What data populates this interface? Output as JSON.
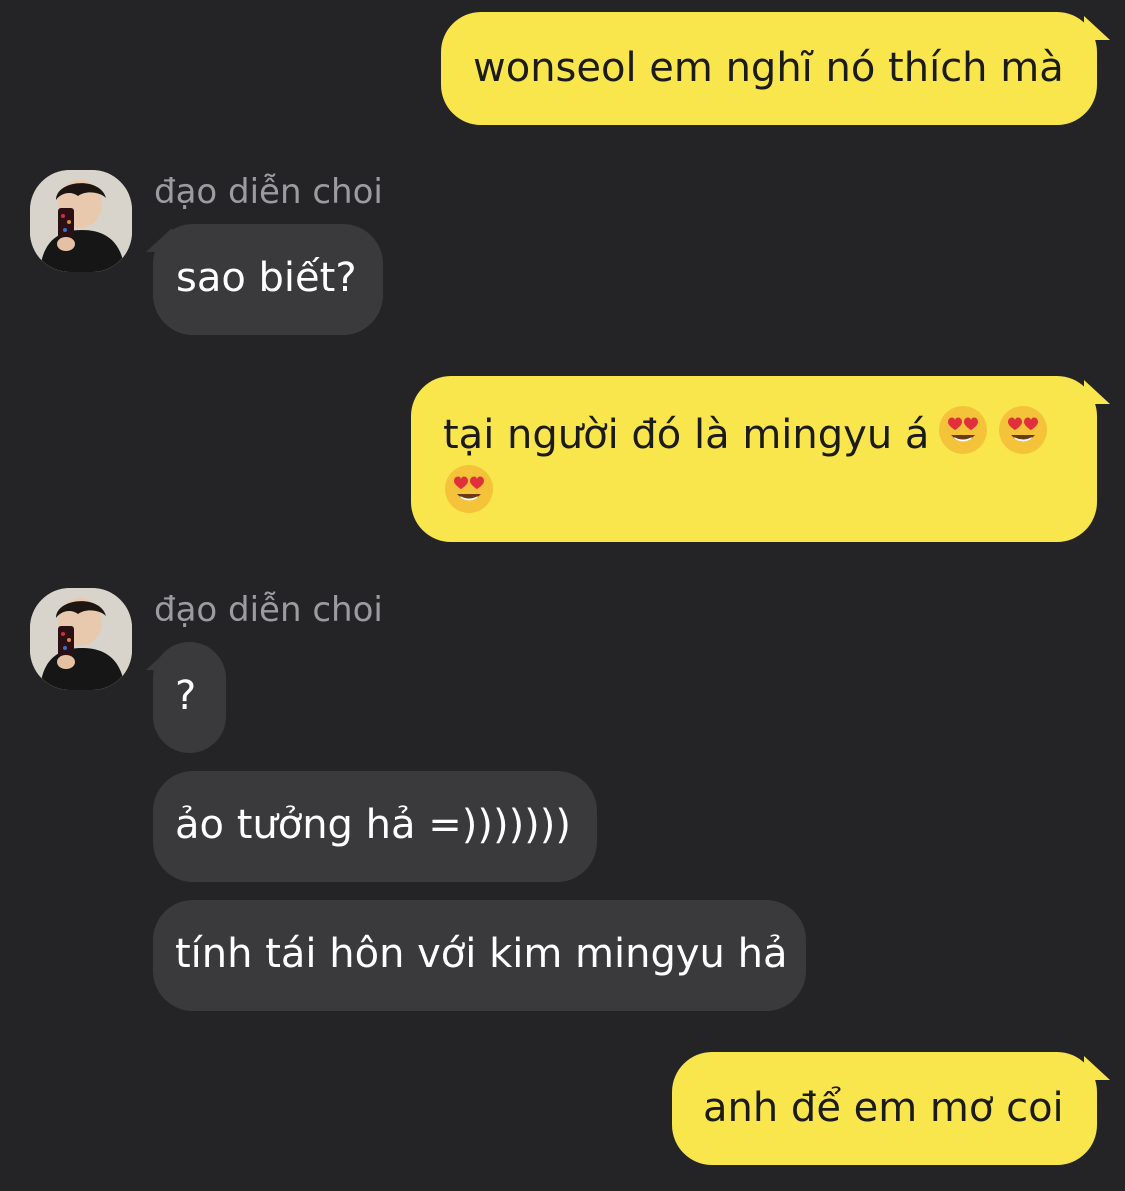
{
  "conversation": {
    "sender_name": "đạo diễn choi",
    "messages": [
      {
        "from": "me",
        "text": "wonseol em nghĩ nó thích mà"
      },
      {
        "from": "them",
        "text": "sao biết?"
      },
      {
        "from": "me",
        "text": "tại người đó là mingyu á",
        "emoji": [
          "heart-eyes-emoji",
          "heart-eyes-emoji",
          "heart-eyes-emoji"
        ]
      },
      {
        "from": "them",
        "text": "?"
      },
      {
        "from": "them",
        "text": "ảo tưởng hả =)))))))"
      },
      {
        "from": "them",
        "text": "tính tái hôn với kim mingyu hả"
      },
      {
        "from": "me",
        "text": "anh để em mơ coi"
      }
    ]
  },
  "colors": {
    "background": "#242426",
    "outgoing_bubble": "#f9e54c",
    "incoming_bubble": "#3a3a3c",
    "sender_name": "#9c9ca0"
  }
}
